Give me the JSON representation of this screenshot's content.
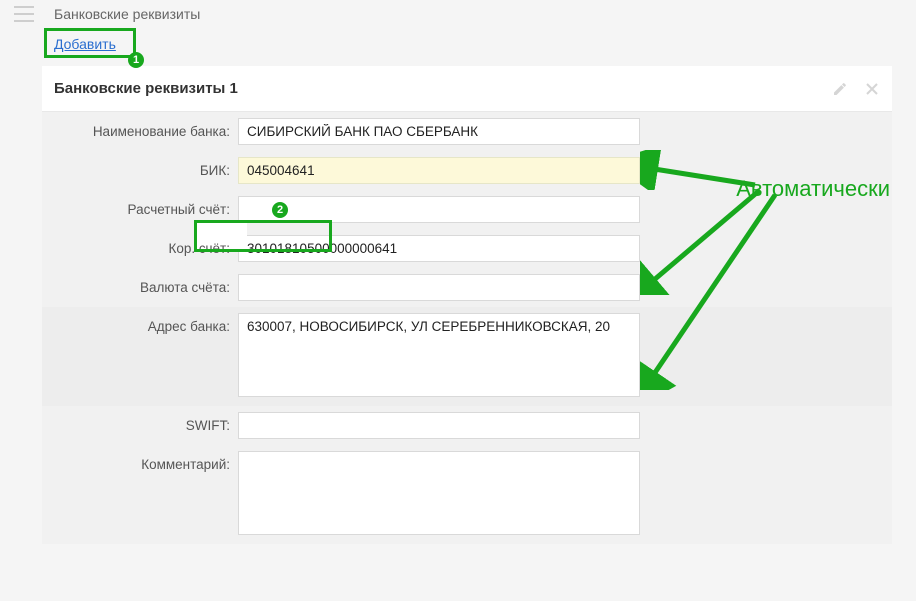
{
  "header": {
    "page_title": "Банковские реквизиты",
    "add_link": "Добавить"
  },
  "panel": {
    "caption": "Банковские реквизиты 1"
  },
  "fields": {
    "bank_name": {
      "label": "Наименование банка:",
      "value": "СИБИРСКИЙ БАНК ПАО СБЕРБАНК"
    },
    "bic": {
      "label": "БИК:",
      "value": "045004641"
    },
    "acct": {
      "label": "Расчетный счёт:",
      "value": ""
    },
    "corr": {
      "label": "Кор. счёт:",
      "value": "30101810500000000641"
    },
    "currency": {
      "label": "Валюта счёта:",
      "value": ""
    },
    "address": {
      "label": "Адрес банка:",
      "value": "630007, НОВОСИБИРСК, УЛ СЕРЕБРЕННИКОВСКАЯ, 20"
    },
    "swift": {
      "label": "SWIFT:",
      "value": ""
    },
    "comment": {
      "label": "Комментарий:",
      "value": ""
    }
  },
  "annotation": {
    "auto_label": "Автоматически",
    "badge1": "1",
    "badge2": "2"
  }
}
